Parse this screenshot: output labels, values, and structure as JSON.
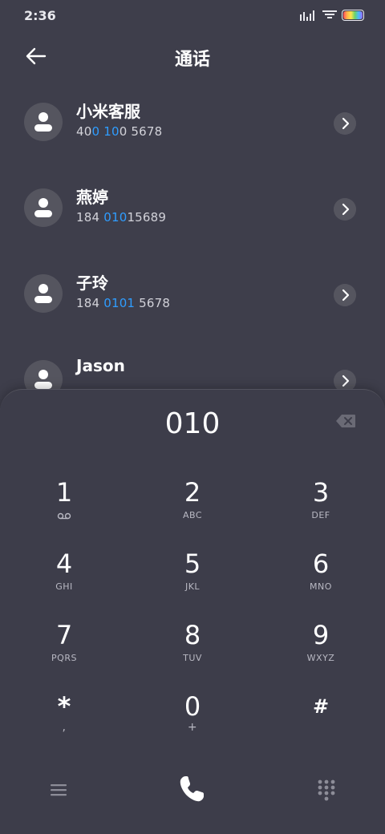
{
  "status": {
    "time": "2:36"
  },
  "header": {
    "title": "通话"
  },
  "contacts": [
    {
      "name": "小米客服",
      "parts": [
        "40",
        "0",
        " ",
        "10",
        "0 5678"
      ],
      "hl": [
        false,
        true,
        false,
        true,
        false
      ]
    },
    {
      "name": "燕婷",
      "parts": [
        "184 ",
        "010",
        "15689"
      ],
      "hl": [
        false,
        true,
        false
      ]
    },
    {
      "name": "子玲",
      "parts": [
        "184 ",
        "0101",
        " 5678"
      ],
      "hl": [
        false,
        true,
        false
      ]
    },
    {
      "name": "Jason",
      "parts": [],
      "hl": []
    }
  ],
  "dialer": {
    "input": "010",
    "keys": [
      {
        "digit": "1",
        "sub": "voicemail"
      },
      {
        "digit": "2",
        "sub": "ABC"
      },
      {
        "digit": "3",
        "sub": "DEF"
      },
      {
        "digit": "4",
        "sub": "GHI"
      },
      {
        "digit": "5",
        "sub": "JKL"
      },
      {
        "digit": "6",
        "sub": "MNO"
      },
      {
        "digit": "7",
        "sub": "PQRS"
      },
      {
        "digit": "8",
        "sub": "TUV"
      },
      {
        "digit": "9",
        "sub": "WXYZ"
      },
      {
        "digit": "*",
        "sub": ","
      },
      {
        "digit": "0",
        "sub": "+"
      },
      {
        "digit": "#",
        "sub": ""
      }
    ]
  },
  "colors": {
    "background": "#3e3e4b",
    "highlight": "#2f9dff",
    "circle": "#55555f"
  }
}
